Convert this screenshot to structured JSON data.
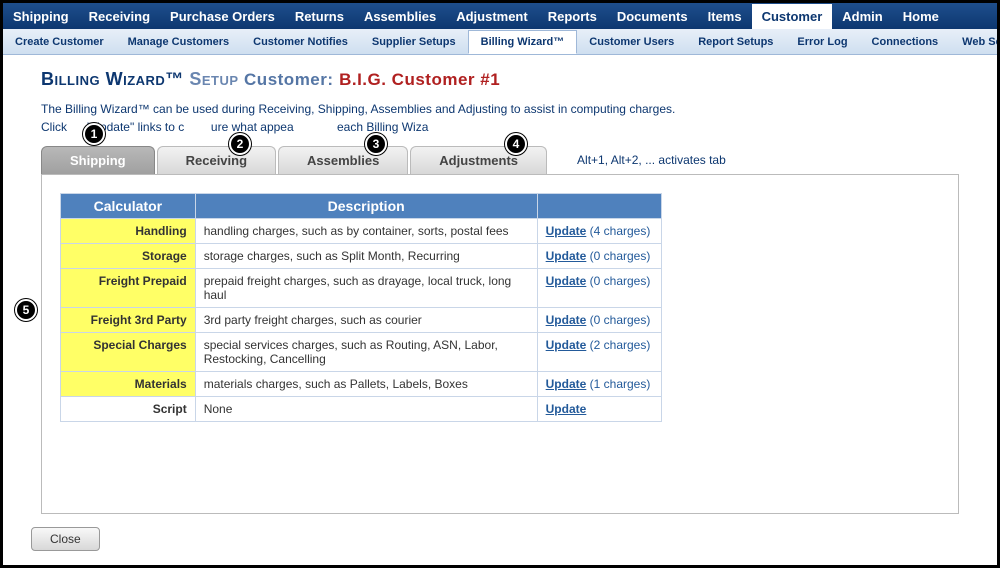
{
  "nav": {
    "items": [
      "Shipping",
      "Receiving",
      "Purchase Orders",
      "Returns",
      "Assemblies",
      "Adjustment",
      "Reports",
      "Documents",
      "Items",
      "Customer",
      "Admin",
      "Home"
    ],
    "active": "Customer"
  },
  "subnav": {
    "items": [
      "Create Customer",
      "Manage Customers",
      "Customer Notifies",
      "Supplier Setups",
      "Billing Wizard™",
      "Customer Users",
      "Report Setups",
      "Error Log",
      "Connections",
      "Web Serv"
    ],
    "active": "Billing Wizard™"
  },
  "title": {
    "main": "Billing Wizard™",
    "setup": "Setup",
    "label": "Customer:",
    "customer": "B.I.G. Customer #1"
  },
  "intro": {
    "line1": "The Billing Wizard™ can be used during Receiving, Shipping, Assemblies and Adjusting to assist in computing charges.",
    "line2_a": "Click",
    "line2_b": "\"Update\" links to c",
    "line2_c": "ure what appea",
    "line2_d": "each Billing Wiza"
  },
  "tabs": {
    "items": [
      "Shipping",
      "Receiving",
      "Assemblies",
      "Adjustments"
    ],
    "active": 0,
    "hint": "Alt+1, Alt+2, ... activates tab"
  },
  "table": {
    "header_calculator": "Calculator",
    "header_description": "Description",
    "rows": [
      {
        "name": "Handling",
        "desc": "handling charges, such as by container, sorts, postal fees",
        "update": "Update",
        "count": "(4 charges)"
      },
      {
        "name": "Storage",
        "desc": "storage charges, such as Split Month, Recurring",
        "update": "Update",
        "count": "(0 charges)"
      },
      {
        "name": "Freight Prepaid",
        "desc": "prepaid freight charges, such as drayage, local truck, long haul",
        "update": "Update",
        "count": "(0 charges)"
      },
      {
        "name": "Freight 3rd Party",
        "desc": "3rd party freight charges, such as courier",
        "update": "Update",
        "count": "(0 charges)"
      },
      {
        "name": "Special Charges",
        "desc": "special services charges, such as Routing, ASN, Labor, Restocking, Cancelling",
        "update": "Update",
        "count": "(2 charges)"
      },
      {
        "name": "Materials",
        "desc": "materials charges, such as Pallets, Labels, Boxes",
        "update": "Update",
        "count": "(1 charges)"
      },
      {
        "name": "Script",
        "desc": "None",
        "update": "Update",
        "count": ""
      }
    ]
  },
  "close_label": "Close",
  "badges": {
    "1": "1",
    "2": "2",
    "3": "3",
    "4": "4",
    "5": "5"
  }
}
